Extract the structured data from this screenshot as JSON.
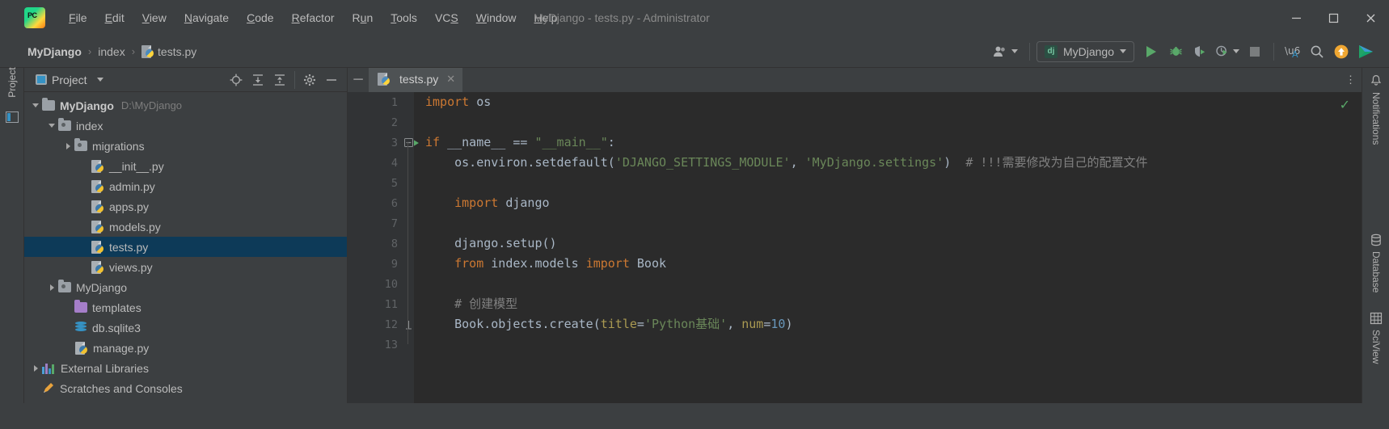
{
  "window": {
    "title": "MyDjango - tests.py - Administrator",
    "app_icon": "pycharm-logo-icon",
    "controls": {
      "minimize": "─",
      "maximize": "☐",
      "close": "✕"
    }
  },
  "menu": {
    "items": [
      {
        "label": "File",
        "mnemonic": "F"
      },
      {
        "label": "Edit",
        "mnemonic": "E"
      },
      {
        "label": "View",
        "mnemonic": "V"
      },
      {
        "label": "Navigate",
        "mnemonic": "N"
      },
      {
        "label": "Code",
        "mnemonic": "C"
      },
      {
        "label": "Refactor",
        "mnemonic": "R"
      },
      {
        "label": "Run",
        "mnemonic": "u"
      },
      {
        "label": "Tools",
        "mnemonic": "T"
      },
      {
        "label": "VCS",
        "mnemonic": "S"
      },
      {
        "label": "Window",
        "mnemonic": "W"
      },
      {
        "label": "Help",
        "mnemonic": "H"
      }
    ]
  },
  "breadcrumb": {
    "project": "MyDjango",
    "separator": "›",
    "folder": "index",
    "file": "tests.py"
  },
  "toolbar": {
    "avatar_icon": "user-account-icon",
    "run_config": {
      "icon": "django-icon",
      "icon_text": "dj",
      "name": "MyDjango"
    },
    "run_button": "run-icon",
    "debug_button": "debug-bug-icon",
    "coverage_button": "run-with-coverage-icon",
    "profile_button": "profiler-icon",
    "stop_button": "stop-icon",
    "translate_button": "translate-icon",
    "search_button": "search-icon",
    "update_button": "update-arrow-icon",
    "ide_button": "ide-play-icon"
  },
  "left_rail": {
    "label": "Project",
    "icon": "project-structure-icon"
  },
  "project_panel": {
    "title": "Project",
    "view_dropdown": "▾",
    "tools": [
      {
        "name": "locate-icon",
        "glyph": "⊕"
      },
      {
        "name": "expand-all-icon",
        "glyph": "⤓"
      },
      {
        "name": "collapse-all-icon",
        "glyph": "⤒"
      },
      {
        "name": "settings-gear-icon",
        "glyph": "⚙"
      },
      {
        "name": "hide-panel-icon",
        "glyph": "─"
      }
    ],
    "tree": [
      {
        "label": "MyDjango",
        "path": "D:\\MyDjango",
        "icon": "folder-icon",
        "arrow": "down",
        "indent": 0,
        "bold": true,
        "selected": false
      },
      {
        "label": "index",
        "path": "",
        "icon": "module-icon",
        "arrow": "down",
        "indent": 1,
        "bold": false,
        "selected": false
      },
      {
        "label": "migrations",
        "path": "",
        "icon": "module-icon",
        "arrow": "right",
        "indent": 2,
        "bold": false,
        "selected": false
      },
      {
        "label": "__init__.py",
        "path": "",
        "icon": "python-file-icon",
        "arrow": "none",
        "indent": 3,
        "bold": false,
        "selected": false
      },
      {
        "label": "admin.py",
        "path": "",
        "icon": "python-file-icon",
        "arrow": "none",
        "indent": 3,
        "bold": false,
        "selected": false
      },
      {
        "label": "apps.py",
        "path": "",
        "icon": "python-file-icon",
        "arrow": "none",
        "indent": 3,
        "bold": false,
        "selected": false
      },
      {
        "label": "models.py",
        "path": "",
        "icon": "python-file-icon",
        "arrow": "none",
        "indent": 3,
        "bold": false,
        "selected": false
      },
      {
        "label": "tests.py",
        "path": "",
        "icon": "python-file-icon",
        "arrow": "none",
        "indent": 3,
        "bold": false,
        "selected": true
      },
      {
        "label": "views.py",
        "path": "",
        "icon": "python-file-icon",
        "arrow": "none",
        "indent": 3,
        "bold": false,
        "selected": false
      },
      {
        "label": "MyDjango",
        "path": "",
        "icon": "module-icon",
        "arrow": "right",
        "indent": 1,
        "bold": false,
        "selected": false
      },
      {
        "label": "templates",
        "path": "",
        "icon": "templates-folder-icon",
        "arrow": "none",
        "indent": 2,
        "bold": false,
        "selected": false
      },
      {
        "label": "db.sqlite3",
        "path": "",
        "icon": "database-file-icon",
        "arrow": "none",
        "indent": 2,
        "bold": false,
        "selected": false
      },
      {
        "label": "manage.py",
        "path": "",
        "icon": "python-file-icon",
        "arrow": "none",
        "indent": 2,
        "bold": false,
        "selected": false
      },
      {
        "label": "External Libraries",
        "path": "",
        "icon": "libraries-icon",
        "arrow": "right",
        "indent": 0,
        "bold": false,
        "selected": false
      },
      {
        "label": "Scratches and Consoles",
        "path": "",
        "icon": "scratches-icon",
        "arrow": "none",
        "indent": 0,
        "bold": false,
        "selected": false
      }
    ]
  },
  "editor": {
    "minimize_glyph": "─",
    "more_glyph": "⋮",
    "tab": {
      "label": "tests.py",
      "icon": "python-file-icon",
      "close": "✕"
    },
    "inspection_status": "✓",
    "line_numbers": [
      "1",
      "2",
      "3",
      "4",
      "5",
      "6",
      "7",
      "8",
      "9",
      "10",
      "11",
      "12",
      "13"
    ],
    "gutter_run_line": 3,
    "fold_lines": [
      3,
      12
    ],
    "lines": [
      {
        "n": 1,
        "tokens": [
          {
            "t": "import",
            "c": "kw"
          },
          {
            "t": " os",
            "c": "fn"
          }
        ]
      },
      {
        "n": 2,
        "tokens": []
      },
      {
        "n": 3,
        "tokens": [
          {
            "t": "if",
            "c": "kw"
          },
          {
            "t": " __name__ == ",
            "c": "fn"
          },
          {
            "t": "\"__main__\"",
            "c": "str"
          },
          {
            "t": ":",
            "c": "fn"
          }
        ]
      },
      {
        "n": 4,
        "tokens": [
          {
            "t": "    os.environ.setdefault(",
            "c": "fn"
          },
          {
            "t": "'DJANGO_SETTINGS_MODULE'",
            "c": "str"
          },
          {
            "t": ", ",
            "c": "fn"
          },
          {
            "t": "'MyDjango.settings'",
            "c": "str"
          },
          {
            "t": ")  ",
            "c": "fn"
          },
          {
            "t": "# !!!需要修改为自己的配置文件",
            "c": "cmt"
          }
        ]
      },
      {
        "n": 5,
        "tokens": []
      },
      {
        "n": 6,
        "tokens": [
          {
            "t": "    ",
            "c": "fn"
          },
          {
            "t": "import",
            "c": "kw"
          },
          {
            "t": " django",
            "c": "fn"
          }
        ]
      },
      {
        "n": 7,
        "tokens": []
      },
      {
        "n": 8,
        "tokens": [
          {
            "t": "    django.setup()",
            "c": "fn"
          }
        ]
      },
      {
        "n": 9,
        "tokens": [
          {
            "t": "    ",
            "c": "fn"
          },
          {
            "t": "from",
            "c": "kw"
          },
          {
            "t": " index.models ",
            "c": "fn"
          },
          {
            "t": "import",
            "c": "kw"
          },
          {
            "t": " Book",
            "c": "fn"
          }
        ]
      },
      {
        "n": 10,
        "tokens": []
      },
      {
        "n": 11,
        "tokens": [
          {
            "t": "    # 创建模型",
            "c": "cmt"
          }
        ]
      },
      {
        "n": 12,
        "tokens": [
          {
            "t": "    Book.objects.create(",
            "c": "fn"
          },
          {
            "t": "title",
            "c": "kwarg"
          },
          {
            "t": "=",
            "c": "fn"
          },
          {
            "t": "'Python基础'",
            "c": "str"
          },
          {
            "t": ", ",
            "c": "fn"
          },
          {
            "t": "num",
            "c": "kwarg"
          },
          {
            "t": "=",
            "c": "fn"
          },
          {
            "t": "10",
            "c": "num"
          },
          {
            "t": ")",
            "c": "fn"
          }
        ]
      },
      {
        "n": 13,
        "tokens": []
      }
    ]
  },
  "right_rail": {
    "tabs": [
      {
        "label": "Notifications",
        "icon": "bell-icon"
      },
      {
        "label": "Database",
        "icon": "database-icon"
      },
      {
        "label": "SciView",
        "icon": "sciview-grid-icon"
      }
    ]
  },
  "colors": {
    "bg_chrome": "#3c3f41",
    "bg_editor": "#2b2b2b",
    "gutter": "#313335",
    "selection": "#0d3a58",
    "accent_green": "#59a869",
    "keyword": "#cc7832",
    "string": "#6a8759",
    "comment": "#808080",
    "number": "#6897bb",
    "text": "#a9b7c6"
  }
}
